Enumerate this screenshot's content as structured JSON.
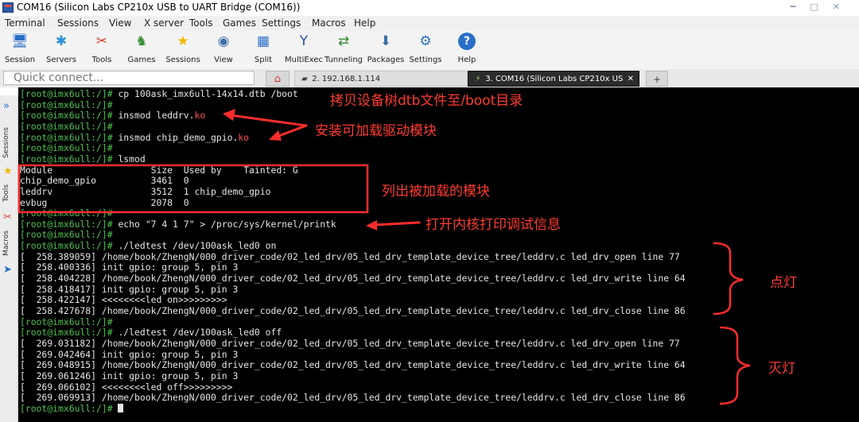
{
  "window": {
    "title": "COM16  (Silicon Labs CP210x USB to UART Bridge (COM16))"
  },
  "menu": [
    "Terminal",
    "Sessions",
    "View",
    "X server",
    "Tools",
    "Games",
    "Settings",
    "Macros",
    "Help"
  ],
  "toolbar": [
    {
      "label": "Session",
      "icon": "session-icon"
    },
    {
      "label": "Servers",
      "icon": "servers-icon"
    },
    {
      "label": "Tools",
      "icon": "tools-icon"
    },
    {
      "label": "Games",
      "icon": "games-icon"
    },
    {
      "label": "Sessions",
      "icon": "star-icon"
    },
    {
      "label": "View",
      "icon": "view-icon"
    },
    {
      "label": "Split",
      "icon": "split-icon"
    },
    {
      "label": "MultiExec",
      "icon": "multiexec-icon"
    },
    {
      "label": "Tunneling",
      "icon": "tunneling-icon"
    },
    {
      "label": "Packages",
      "icon": "packages-icon"
    },
    {
      "label": "Settings",
      "icon": "settings-icon"
    },
    {
      "label": "Help",
      "icon": "help-icon"
    }
  ],
  "quick_connect": {
    "placeholder": "Quick connect..."
  },
  "tabs": [
    {
      "label": "2. 192.168.1.114"
    },
    {
      "label": "3. COM16  (Silicon Labs CP210x US"
    }
  ],
  "sidebar": {
    "labels": [
      "Sessions",
      "Tools",
      "Macros"
    ]
  },
  "terminal": {
    "prompt": "[root@imx6ull:/]#",
    "lines": [
      {
        "p": "[root@imx6ull:/]#",
        "t": " cp 100ask_imx6ull-14x14.dtb /boot"
      },
      {
        "p": "[root@imx6ull:/]#",
        "t": ""
      },
      {
        "p": "[root@imx6ull:/]#",
        "t": " insmod leddrv.",
        "ko": "ko"
      },
      {
        "p": "[root@imx6ull:/]#",
        "t": ""
      },
      {
        "p": "[root@imx6ull:/]#",
        "t": " insmod chip_demo_gpio.",
        "ko": "ko"
      },
      {
        "p": "[root@imx6ull:/]#",
        "t": ""
      },
      {
        "p": "[root@imx6ull:/]#",
        "t": " lsmod"
      },
      {
        "p": "",
        "t": "Module                  Size  Used by    Tainted: G"
      },
      {
        "p": "",
        "t": "chip_demo_gpio          3461  0"
      },
      {
        "p": "",
        "t": "leddrv                  3512  1 chip_demo_gpio"
      },
      {
        "p": "",
        "t": "evbug                   2078  0"
      },
      {
        "p": "[root@imx6ull:/]#",
        "t": ""
      },
      {
        "p": "[root@imx6ull:/]#",
        "t": " echo \"7 4 1 7\" > /proc/sys/kernel/printk"
      },
      {
        "p": "[root@imx6ull:/]#",
        "t": ""
      },
      {
        "p": "[root@imx6ull:/]#",
        "t": " ./ledtest /dev/100ask_led0 on"
      },
      {
        "p": "",
        "t": "[  258.389059] /home/book/ZhengN/000_driver_code/02_led_drv/05_led_drv_template_device_tree/leddrv.c led_drv_open line 77"
      },
      {
        "p": "",
        "t": "[  258.400336] init gpio: group 5, pin 3"
      },
      {
        "p": "",
        "t": "[  258.404228] /home/book/ZhengN/000_driver_code/02_led_drv/05_led_drv_template_device_tree/leddrv.c led_drv_write line 64"
      },
      {
        "p": "",
        "t": "[  258.418417] init gpio: group 5, pin 3"
      },
      {
        "p": "",
        "t": "[  258.422147] <<<<<<<<led on>>>>>>>>>"
      },
      {
        "p": "",
        "t": "[  258.427678] /home/book/ZhengN/000_driver_code/02_led_drv/05_led_drv_template_device_tree/leddrv.c led_drv_close line 86"
      },
      {
        "p": "[root@imx6ull:/]#",
        "t": ""
      },
      {
        "p": "[root@imx6ull:/]#",
        "t": " ./ledtest /dev/100ask_led0 off"
      },
      {
        "p": "",
        "t": "[  269.031182] /home/book/ZhengN/000_driver_code/02_led_drv/05_led_drv_template_device_tree/leddrv.c led_drv_open line 77"
      },
      {
        "p": "",
        "t": "[  269.042464] init gpio: group 5, pin 3"
      },
      {
        "p": "",
        "t": "[  269.048915] /home/book/ZhengN/000_driver_code/02_led_drv/05_led_drv_template_device_tree/leddrv.c led_drv_write line 64"
      },
      {
        "p": "",
        "t": "[  269.061246] init gpio: group 5, pin 3"
      },
      {
        "p": "",
        "t": "[  269.066102] <<<<<<<<led off>>>>>>>>>"
      },
      {
        "p": "",
        "t": "[  269.069913] /home/book/ZhengN/000_driver_code/02_led_drv/05_led_drv_template_device_tree/leddrv.c led_drv_close line 86"
      },
      {
        "p": "[root@imx6ull:/]#",
        "t": "",
        "cursor": true
      }
    ]
  },
  "annotations": {
    "copy_dtb": "拷贝设备树dtb文件至/boot目录",
    "load_modules": "安装可加载驱动模块",
    "list_modules": "列出被加载的模块",
    "printk": "打开内核打印调试信息",
    "led_on": "点灯",
    "led_off": "灭灯"
  },
  "colors": {
    "annotation": "#ff3b30",
    "prompt": "#4fc24f",
    "terminal_bg": "#000000",
    "ko": "#ff4d4d"
  }
}
